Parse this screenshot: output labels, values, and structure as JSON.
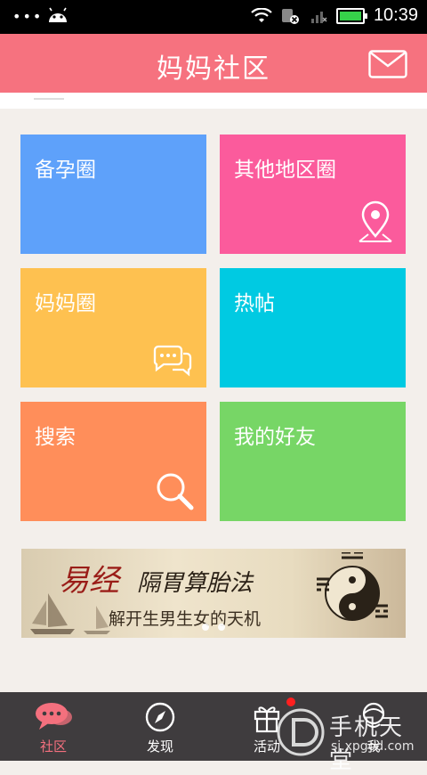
{
  "status_bar": {
    "time": "10:39"
  },
  "header": {
    "title": "妈妈社区"
  },
  "tiles": [
    {
      "label": "备孕圈",
      "color": "#5ea1fa"
    },
    {
      "label": "其他地区圈",
      "color": "#fb5b9c",
      "icon": "location-pin-icon"
    },
    {
      "label": "妈妈圈",
      "color": "#fec150",
      "icon": "chat-bubbles-icon"
    },
    {
      "label": "热帖",
      "color": "#00cae2"
    },
    {
      "label": "搜索",
      "color": "#ff8e5a",
      "icon": "search-icon"
    },
    {
      "label": "我的好友",
      "color": "#77d666"
    }
  ],
  "banner": {
    "headline_main": "易经",
    "headline_rest": "隔胃算胎法",
    "subtitle": "解开生男生女的天机"
  },
  "tabs": [
    {
      "label": "社区",
      "icon": "community-chat-icon",
      "active": true
    },
    {
      "label": "发现",
      "icon": "compass-icon",
      "active": false
    },
    {
      "label": "活动",
      "icon": "gift-icon",
      "active": false,
      "badge": true
    },
    {
      "label": "我",
      "icon": "profile-icon",
      "active": false
    }
  ],
  "watermark": {
    "main": "手机天堂",
    "sub": "sj.xpgod.com"
  },
  "colors": {
    "accent": "#f6727f",
    "tabbar": "#3f3c3e",
    "active_tab": "#f4707e"
  }
}
